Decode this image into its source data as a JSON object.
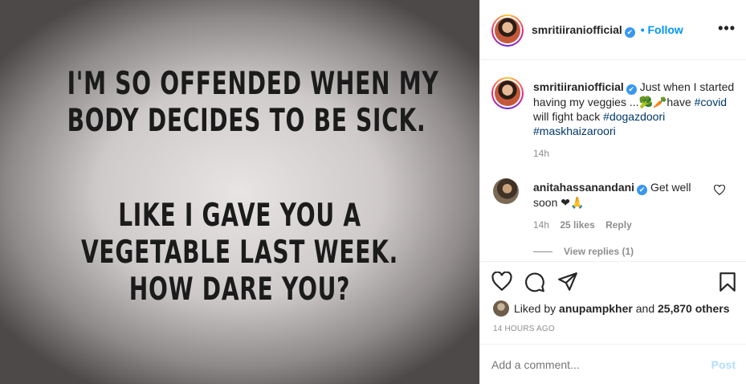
{
  "post_image": {
    "lines_block_1": [
      "I'M SO OFFENDED WHEN MY",
      "BODY DECIDES TO BE SICK."
    ],
    "lines_block_2": [
      "LIKE I GAVE YOU A",
      "VEGETABLE LAST WEEK.",
      "HOW DARE YOU?"
    ]
  },
  "header": {
    "username": "smritiiraniofficial",
    "verified": "✔",
    "follow_label": "• Follow",
    "more_icon": "more-options-icon",
    "more_glyph": "•••"
  },
  "caption": {
    "username": "smritiiraniofficial",
    "text": "Just when I started having my veggies ...🥦🥕have",
    "hashtag_1": "#covid",
    "text_2": "will fight back",
    "hashtag_2": "#dogazdoori",
    "hashtag_3": "#maskhaizaroori",
    "time": "14h"
  },
  "comment": {
    "username": "anitahassanandani",
    "text": "Get well soon ❤🙏",
    "time": "14h",
    "likes": "25 likes",
    "reply_label": "Reply",
    "view_replies": "View replies (1)"
  },
  "actions": {
    "liked_by_prefix": "Liked by",
    "liked_by_user": "anupampkher",
    "liked_by_and": "and",
    "liked_by_others": "25,870 others",
    "timestamp": "14 HOURS AGO"
  },
  "comment_input": {
    "placeholder": "Add a comment...",
    "post_label": "Post"
  },
  "colors": {
    "link_blue": "#0095f6",
    "hashtag": "#00376b",
    "verified_blue": "#3897f0",
    "muted": "#8e8e8e"
  }
}
